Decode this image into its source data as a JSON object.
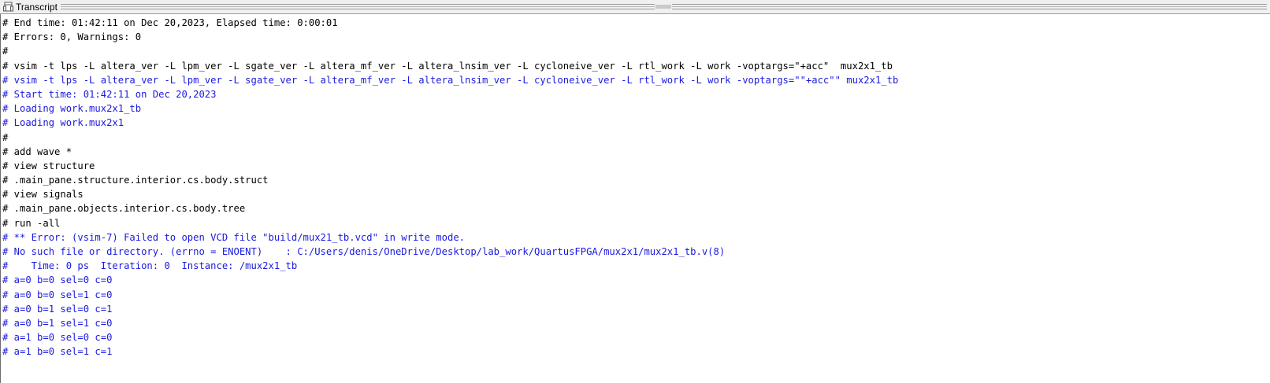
{
  "window": {
    "title": "Transcript"
  },
  "transcript": {
    "lines": [
      {
        "text": "# End time: 01:42:11 on Dec 20,2023, Elapsed time: 0:00:01",
        "color": "black"
      },
      {
        "text": "# Errors: 0, Warnings: 0",
        "color": "black"
      },
      {
        "text": "#",
        "color": "black"
      },
      {
        "text": "# vsim -t lps -L altera_ver -L lpm_ver -L sgate_ver -L altera_mf_ver -L altera_lnsim_ver -L cycloneive_ver -L rtl_work -L work -voptargs=\"+acc\"  mux2x1_tb",
        "color": "black"
      },
      {
        "text": "# vsim -t lps -L altera_ver -L lpm_ver -L sgate_ver -L altera_mf_ver -L altera_lnsim_ver -L cycloneive_ver -L rtl_work -L work -voptargs=\"\"+acc\"\" mux2x1_tb",
        "color": "blue"
      },
      {
        "text": "# Start time: 01:42:11 on Dec 20,2023",
        "color": "blue"
      },
      {
        "text": "# Loading work.mux2x1_tb",
        "color": "blue"
      },
      {
        "text": "# Loading work.mux2x1",
        "color": "blue"
      },
      {
        "text": "#",
        "color": "black"
      },
      {
        "text": "# add wave *",
        "color": "black"
      },
      {
        "text": "# view structure",
        "color": "black"
      },
      {
        "text": "# .main_pane.structure.interior.cs.body.struct",
        "color": "black"
      },
      {
        "text": "# view signals",
        "color": "black"
      },
      {
        "text": "# .main_pane.objects.interior.cs.body.tree",
        "color": "black"
      },
      {
        "text": "# run -all",
        "color": "black"
      },
      {
        "text": "# ** Error: (vsim-7) Failed to open VCD file \"build/mux21_tb.vcd\" in write mode.",
        "color": "blue"
      },
      {
        "text": "# No such file or directory. (errno = ENOENT)    : C:/Users/denis/OneDrive/Desktop/lab_work/QuartusFPGA/mux2x1/mux2x1_tb.v(8)",
        "color": "blue"
      },
      {
        "text": "#    Time: 0 ps  Iteration: 0  Instance: /mux2x1_tb",
        "color": "blue"
      },
      {
        "text": "# a=0 b=0 sel=0 c=0",
        "color": "blue"
      },
      {
        "text": "# a=0 b=0 sel=1 c=0",
        "color": "blue"
      },
      {
        "text": "# a=0 b=1 sel=0 c=1",
        "color": "blue"
      },
      {
        "text": "# a=0 b=1 sel=1 c=0",
        "color": "blue"
      },
      {
        "text": "# a=1 b=0 sel=0 c=0",
        "color": "blue"
      },
      {
        "text": "# a=1 b=0 sel=1 c=1",
        "color": "blue"
      }
    ]
  }
}
